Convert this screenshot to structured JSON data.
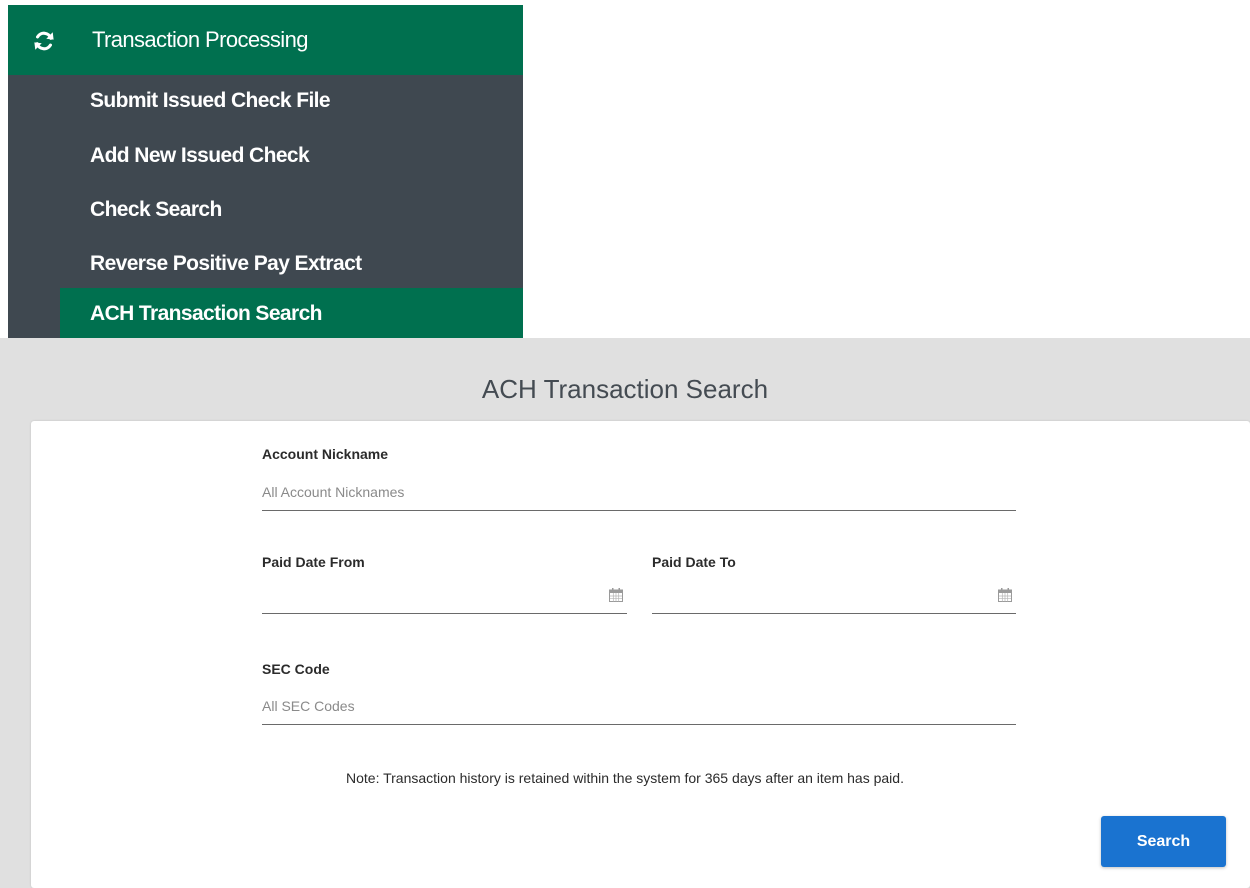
{
  "menu": {
    "header": {
      "title": "Transaction Processing",
      "icon": "refresh-icon"
    },
    "items": [
      {
        "label": "Submit Issued Check File"
      },
      {
        "label": "Add New Issued Check"
      },
      {
        "label": "Check Search"
      },
      {
        "label": "Reverse Positive Pay Extract"
      },
      {
        "label": "ACH Transaction Search",
        "active": true
      }
    ],
    "colors": {
      "header": "#00704f",
      "background": "#3f4850",
      "active": "#00704f"
    }
  },
  "page": {
    "title": "ACH Transaction Search"
  },
  "form": {
    "account_nickname": {
      "label": "Account Nickname",
      "placeholder": "All Account Nicknames"
    },
    "paid_date_from": {
      "label": "Paid Date From",
      "icon": "calendar-icon"
    },
    "paid_date_to": {
      "label": "Paid Date To",
      "icon": "calendar-icon"
    },
    "sec_code": {
      "label": "SEC Code",
      "placeholder": "All SEC Codes"
    },
    "note": "Note: Transaction history is retained within the system for 365 days after an item has paid.",
    "search_label": "Search",
    "button_color": "#1a73d0"
  }
}
